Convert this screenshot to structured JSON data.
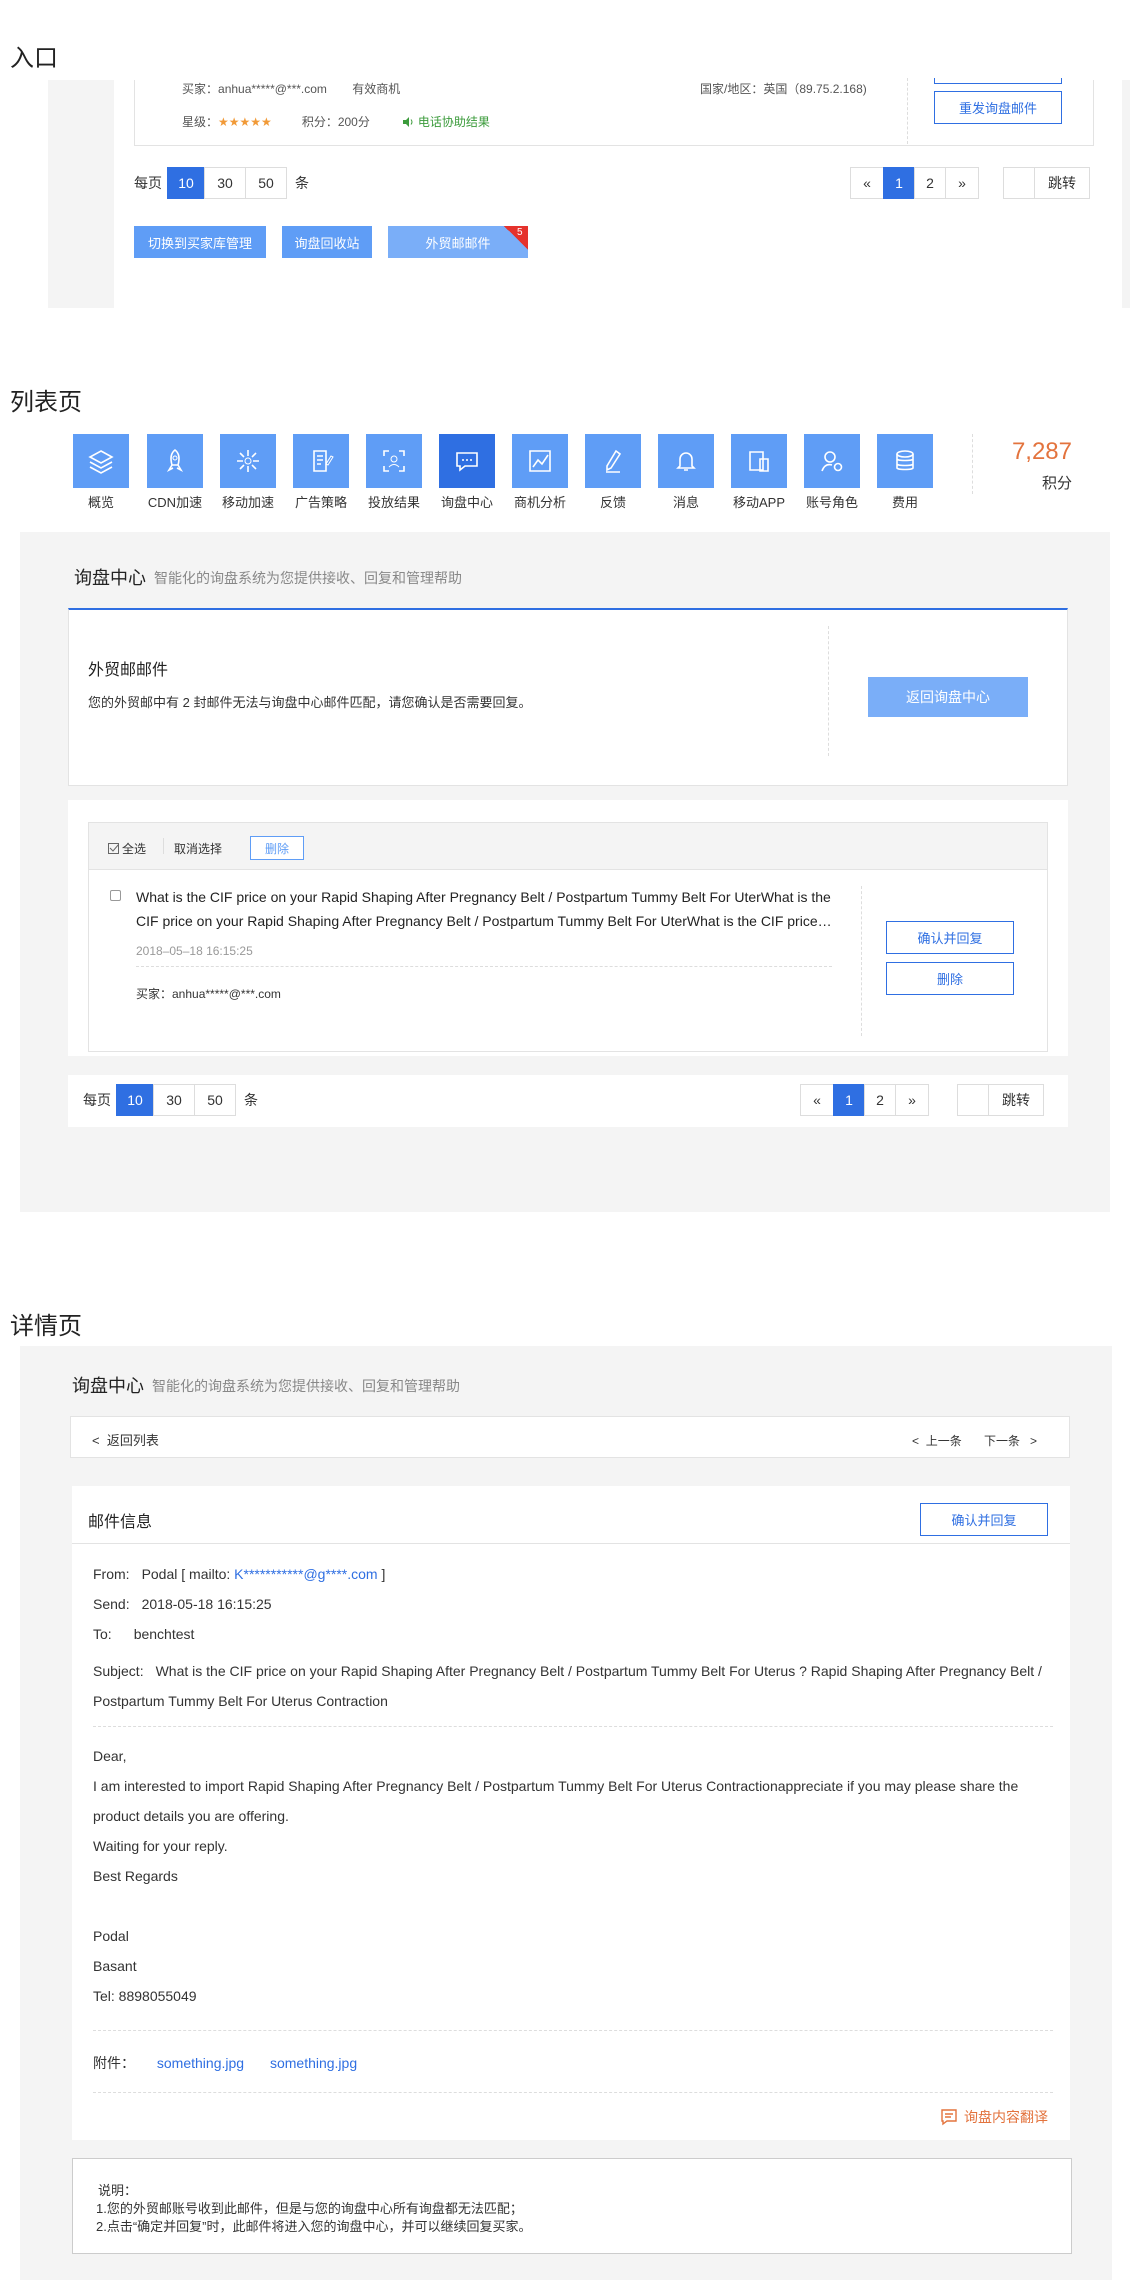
{
  "sections": {
    "entry": "入口",
    "list": "列表页",
    "detail": "详情页"
  },
  "entry": {
    "buyer_label": "买家：",
    "buyer_email": "anhua*****@***.com",
    "buyer_status": "有效商机",
    "country_label": "国家/地区：",
    "country_value": "英国（89.75.2.168)",
    "star_label": "星级：",
    "stars": "★★★★★",
    "points_label": "积分：",
    "points_value": "200分",
    "phone_help": "电话协助结果",
    "resend_button": "重发询盘邮件",
    "per_page_label": "每页",
    "per_page_options": [
      "10",
      "30",
      "50"
    ],
    "per_page_unit": "条",
    "pages": [
      "«",
      "1",
      "2",
      "»"
    ],
    "jump_label": "跳转",
    "switch_button": "切换到买家库管理",
    "recycle_button": "询盘回收站",
    "foreign_mail_button": "外贸邮邮件",
    "foreign_mail_badge": "5"
  },
  "nav": {
    "items": [
      {
        "label": "概览",
        "icon": "layers-icon"
      },
      {
        "label": "CDN加速",
        "icon": "rocket-icon"
      },
      {
        "label": "移动加速",
        "icon": "spinner-icon"
      },
      {
        "label": "广告策略",
        "icon": "notepad-icon"
      },
      {
        "label": "投放结果",
        "icon": "focus-icon"
      },
      {
        "label": "询盘中心",
        "icon": "chat-icon"
      },
      {
        "label": "商机分析",
        "icon": "chart-icon"
      },
      {
        "label": "反馈",
        "icon": "pencil-icon"
      },
      {
        "label": "消息",
        "icon": "bell-icon"
      },
      {
        "label": "移动APP",
        "icon": "devices-icon"
      },
      {
        "label": "账号角色",
        "icon": "user-settings-icon"
      },
      {
        "label": "费用",
        "icon": "coins-icon"
      }
    ],
    "active_index": 5,
    "points_value": "7,287",
    "points_label": "积分"
  },
  "list": {
    "title": "询盘中心",
    "subtitle": "智能化的询盘系统为您提供接收、回复和管理帮助",
    "notice_title": "外贸邮邮件",
    "notice_text": "您的外贸邮中有 2 封邮件无法与询盘中心邮件匹配，请您确认是否需要回复。",
    "back_button": "返回询盘中心",
    "select_all": "全选",
    "deselect": "取消选择",
    "delete_button": "删除",
    "item_text": "What is the CIF price on your Rapid Shaping After Pregnancy Belt / Postpartum Tummy Belt For UterWhat is the CIF price on your Rapid Shaping After Pregnancy Belt / Postpartum Tummy Belt For UterWhat is the CIF price…",
    "item_time": "2018–05–18 16:15:25",
    "item_buyer": "买家：anhua*****@***.com",
    "confirm_reply": "确认并回复",
    "item_delete": "删除",
    "per_page_label": "每页",
    "per_page_options": [
      "10",
      "30",
      "50"
    ],
    "per_page_unit": "条",
    "pages": [
      "«",
      "1",
      "2",
      "»"
    ],
    "jump_label": "跳转"
  },
  "detail": {
    "title": "询盘中心",
    "subtitle": "智能化的询盘系统为您提供接收、回复和管理帮助",
    "back_list": "返回列表",
    "prev": "上一条",
    "next": "下一条",
    "mail_info": "邮件信息",
    "confirm_reply": "确认并回复",
    "from_label": "From:",
    "from_name": "Podal [ mailto: ",
    "from_email": "K***********@g****.com",
    "from_end": " ]",
    "send_label": "Send:",
    "send_value": "2018-05-18 16:15:25",
    "to_label": "To:",
    "to_value": "benchtest",
    "subject_label": "Subject:",
    "subject_line1": "What is the CIF price on your Rapid Shaping After Pregnancy Belt / Postpartum Tummy Belt For Uterus ? Rapid Shaping After Pregnancy Belt /",
    "subject_line2": "Postpartum Tummy Belt For Uterus Contraction",
    "body": [
      "Dear,",
      "I am interested to import Rapid Shaping After Pregnancy Belt / Postpartum Tummy Belt For Uterus Contractionappreciate if you may please share the",
      "product details you are offering.",
      "Waiting for your reply.",
      "Best Regards",
      "",
      "Podal",
      "Basant",
      "Tel: 8898055049"
    ],
    "attach_label": "附件：",
    "attachments": [
      "something.jpg",
      "something.jpg"
    ],
    "translate": "询盘内容翻译",
    "note_title": "说明：",
    "note_1": "1.您的外贸邮账号收到此邮件，但是与您的询盘中心所有询盘都无法匹配；",
    "note_2": "2.点击“确定并回复”时，此邮件将进入您的询盘中心，并可以继续回复买家。"
  },
  "colors": {
    "primary": "#2f6fe2",
    "light_blue": "#5f9df6",
    "orange": "#e3733d",
    "green": "#3b9b3b",
    "star": "#f19a38"
  }
}
